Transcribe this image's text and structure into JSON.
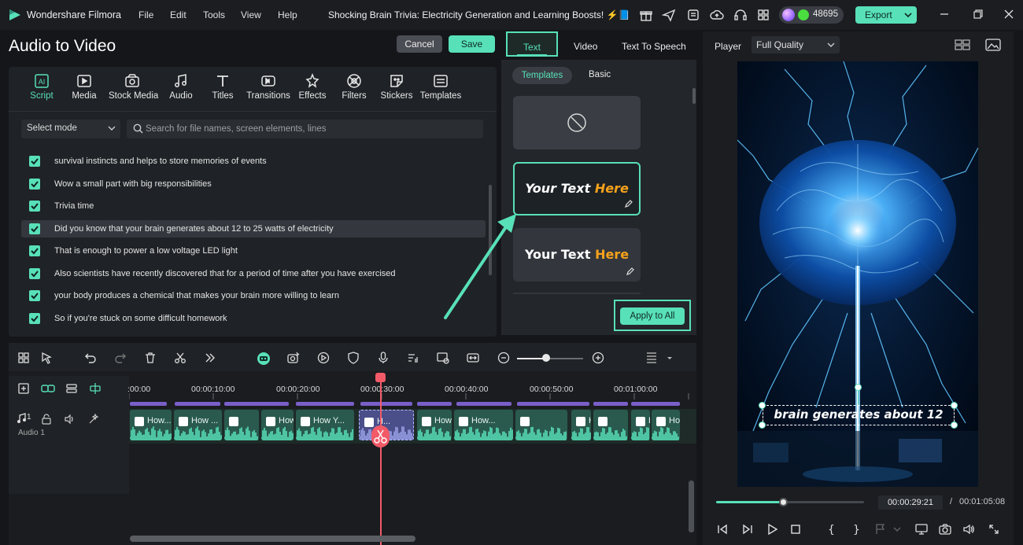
{
  "app": {
    "name": "Wondershare Filmora",
    "menu": [
      "File",
      "Edit",
      "Tools",
      "View",
      "Help"
    ],
    "project_title": "Shocking Brain Trivia: Electricity Generation and Learning Boosts! ⚡📘",
    "credits": "48695",
    "export_label": "Export"
  },
  "header": {
    "title": "Audio to Video",
    "cancel_label": "Cancel",
    "save_label": "Save"
  },
  "tools": [
    {
      "label": "Script",
      "icon": "script-icon"
    },
    {
      "label": "Media",
      "icon": "media-icon"
    },
    {
      "label": "Stock Media",
      "icon": "stock-media-icon"
    },
    {
      "label": "Audio",
      "icon": "audio-icon"
    },
    {
      "label": "Titles",
      "icon": "titles-icon"
    },
    {
      "label": "Transitions",
      "icon": "transitions-icon"
    },
    {
      "label": "Effects",
      "icon": "effects-icon"
    },
    {
      "label": "Filters",
      "icon": "filters-icon"
    },
    {
      "label": "Stickers",
      "icon": "stickers-icon"
    },
    {
      "label": "Templates",
      "icon": "templates-icon"
    }
  ],
  "script": {
    "select_mode": "Select mode",
    "search_placeholder": "Search for file names, screen elements, lines",
    "lines": [
      "survival instincts and helps to store memories of events",
      "Wow a small part with big responsibilities",
      "Trivia time",
      "Did you know that your brain generates about 12 to 25 watts of electricity",
      "That is enough to power a low voltage LED light",
      "Also scientists have recently discovered that for a period of time after you have exercised",
      "your body produces a chemical that makes your brain more willing to learn",
      "So if you're stuck on some difficult homework"
    ]
  },
  "text_panel": {
    "tabs": [
      "Text",
      "Video",
      "Text To Speech"
    ],
    "subtabs": [
      "Templates",
      "Basic"
    ],
    "template_text_a": "Your Text ",
    "template_text_b": "Here",
    "apply_all": "Apply to All"
  },
  "player": {
    "label": "Player",
    "quality": "Full Quality",
    "caption": "brain generates about 12",
    "current_time": "00:00:29:21",
    "separator": "/",
    "total_time": "00:01:05:08",
    "progress": 0.46
  },
  "timeline": {
    "ruler": [
      ":00:00",
      "00:00:10:00",
      "00:00:20:00",
      "00:00:30:00",
      "00:00:40:00",
      "00:00:50:00",
      "00:01:00:00"
    ],
    "track_name": "Audio 1",
    "track_number": "1",
    "clip_labels": [
      "How...",
      "How ...",
      "",
      "How...",
      "How Y...",
      "H...",
      "How Yo...",
      "How...",
      "",
      "How...",
      "",
      "How..."
    ],
    "zoom": 0.44
  },
  "colors": {
    "accent": "#58e0b9",
    "playhead": "#f25a68",
    "template_highlight": "#f7a21b"
  }
}
